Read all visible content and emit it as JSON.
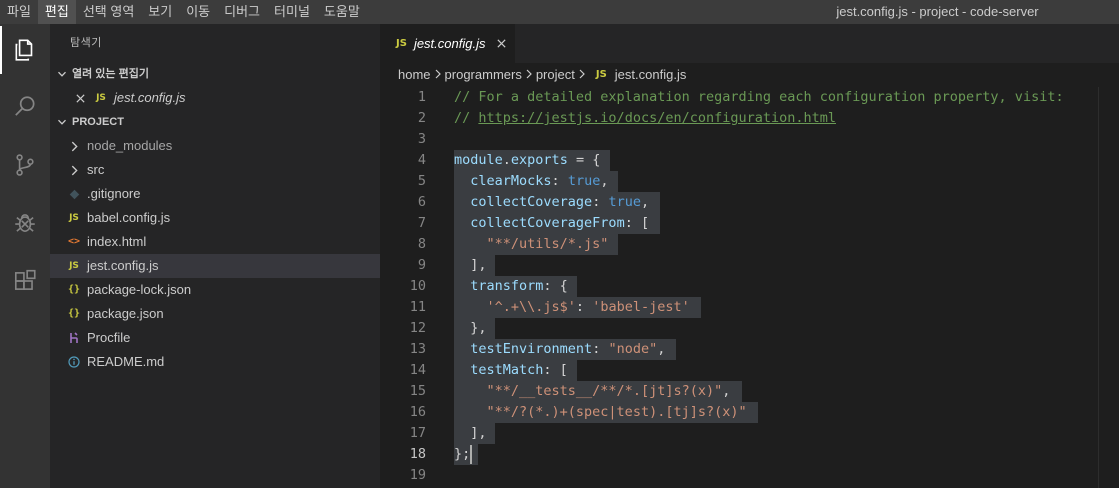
{
  "menu": {
    "items": [
      "파일",
      "편집",
      "선택 영역",
      "보기",
      "이동",
      "디버그",
      "터미널",
      "도움말"
    ],
    "active_index": 1
  },
  "window_title": "jest.config.js - project - code-server",
  "activity_bar": {
    "items": [
      "files-icon",
      "search-icon",
      "source-control-icon",
      "debug-icon",
      "extensions-icon"
    ],
    "active": "files-icon"
  },
  "sidebar": {
    "title": "탐색기",
    "open_editors": {
      "label": "열려 있는 편집기",
      "items": [
        {
          "name": "jest.config.js",
          "type": "js"
        }
      ]
    },
    "project": {
      "label": "PROJECT",
      "items": [
        {
          "name": "node_modules",
          "type": "folder",
          "dim": true
        },
        {
          "name": "src",
          "type": "folder"
        },
        {
          "name": ".gitignore",
          "type": "git"
        },
        {
          "name": "babel.config.js",
          "type": "js"
        },
        {
          "name": "index.html",
          "type": "html"
        },
        {
          "name": "jest.config.js",
          "type": "js",
          "selected": true
        },
        {
          "name": "package-lock.json",
          "type": "json"
        },
        {
          "name": "package.json",
          "type": "json"
        },
        {
          "name": "Procfile",
          "type": "procfile"
        },
        {
          "name": "README.md",
          "type": "info"
        }
      ]
    }
  },
  "editor": {
    "tab": {
      "label": "jest.config.js",
      "icon": "js-file-icon"
    },
    "breadcrumbs": [
      "home",
      "programmers",
      "project",
      "jest.config.js"
    ],
    "code": [
      {
        "n": "1",
        "tokens": [
          [
            "com",
            "// For a detailed explanation regarding each configuration property, visit:"
          ]
        ]
      },
      {
        "n": "2",
        "tokens": [
          [
            "com",
            "// "
          ],
          [
            "link",
            "https://jestjs.io/docs/en/configuration.html"
          ]
        ]
      },
      {
        "n": "3",
        "tokens": []
      },
      {
        "n": "4",
        "tokens": [
          [
            "var",
            "module"
          ],
          [
            "punc",
            "."
          ],
          [
            "var",
            "exports"
          ],
          [
            "punc",
            " = {"
          ]
        ]
      },
      {
        "n": "5",
        "tokens": [
          [
            "punc",
            "  "
          ],
          [
            "var",
            "clearMocks"
          ],
          [
            "punc",
            ": "
          ],
          [
            "kw",
            "true"
          ],
          [
            "punc",
            ","
          ]
        ]
      },
      {
        "n": "6",
        "tokens": [
          [
            "punc",
            "  "
          ],
          [
            "var",
            "collectCoverage"
          ],
          [
            "punc",
            ": "
          ],
          [
            "kw",
            "true"
          ],
          [
            "punc",
            ","
          ]
        ]
      },
      {
        "n": "7",
        "tokens": [
          [
            "punc",
            "  "
          ],
          [
            "var",
            "collectCoverageFrom"
          ],
          [
            "punc",
            ": ["
          ]
        ]
      },
      {
        "n": "8",
        "tokens": [
          [
            "punc",
            "    "
          ],
          [
            "str",
            "\"**/utils/*.js\""
          ]
        ]
      },
      {
        "n": "9",
        "tokens": [
          [
            "punc",
            "  ],"
          ]
        ]
      },
      {
        "n": "10",
        "tokens": [
          [
            "punc",
            "  "
          ],
          [
            "var",
            "transform"
          ],
          [
            "punc",
            ": {"
          ]
        ]
      },
      {
        "n": "11",
        "tokens": [
          [
            "punc",
            "    "
          ],
          [
            "str",
            "'^.+\\\\.js$'"
          ],
          [
            "punc",
            ": "
          ],
          [
            "str",
            "'babel-jest'"
          ]
        ]
      },
      {
        "n": "12",
        "tokens": [
          [
            "punc",
            "  },"
          ]
        ]
      },
      {
        "n": "13",
        "tokens": [
          [
            "punc",
            "  "
          ],
          [
            "var",
            "testEnvironment"
          ],
          [
            "punc",
            ": "
          ],
          [
            "str",
            "\"node\""
          ],
          [
            "punc",
            ","
          ]
        ]
      },
      {
        "n": "14",
        "tokens": [
          [
            "punc",
            "  "
          ],
          [
            "var",
            "testMatch"
          ],
          [
            "punc",
            ": ["
          ]
        ]
      },
      {
        "n": "15",
        "tokens": [
          [
            "punc",
            "    "
          ],
          [
            "str",
            "\"**/__tests__/**/*.[jt]s?(x)\""
          ],
          [
            "punc",
            ","
          ]
        ]
      },
      {
        "n": "16",
        "tokens": [
          [
            "punc",
            "    "
          ],
          [
            "str",
            "\"**/?(*.)+(spec|test).[tj]s?(x)\""
          ]
        ]
      },
      {
        "n": "17",
        "tokens": [
          [
            "punc",
            "  ],"
          ]
        ]
      },
      {
        "n": "18",
        "tokens": [
          [
            "punc",
            "};"
          ]
        ]
      },
      {
        "n": "19",
        "tokens": []
      }
    ],
    "selection_lines": [
      4,
      18
    ],
    "cursor_line": 18
  },
  "colors": {
    "titlebar": "#3c3c3c",
    "activitybar": "#333333",
    "sidebar": "#252526",
    "editor": "#1e1e1e",
    "selection": "#3a3d41",
    "comment": "#6a9955",
    "keyword": "#569cd6",
    "string": "#ce9178",
    "variable": "#9cdcfe"
  }
}
